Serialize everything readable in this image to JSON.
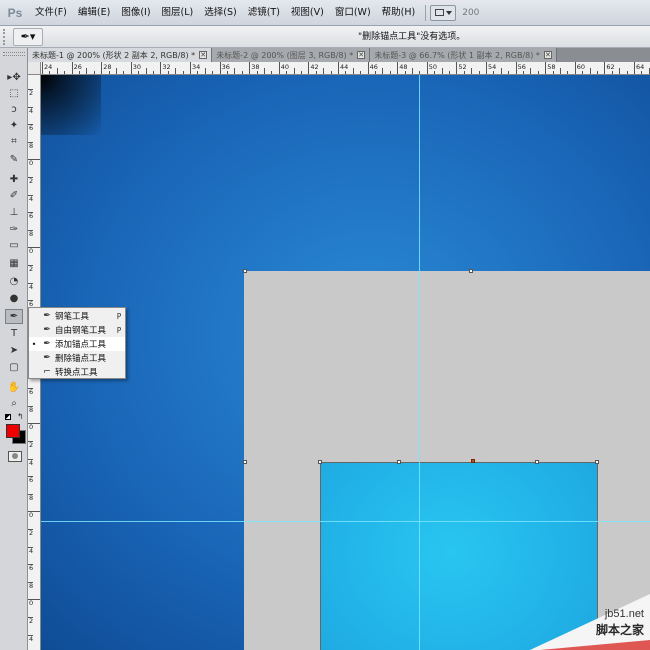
{
  "app": {
    "logo": "Ps"
  },
  "menubar": {
    "items": [
      "文件(F)",
      "编辑(E)",
      "图像(I)",
      "图层(L)",
      "选择(S)",
      "滤镜(T)",
      "视图(V)",
      "窗口(W)",
      "帮助(H)"
    ],
    "zoom": "200"
  },
  "options": {
    "tool_icon": "✒▾",
    "message": "\"删除锚点工具\"没有选项。"
  },
  "tabs": [
    {
      "label": "未标题-1 @ 200% (形状 2 副本 2, RGB/8) *",
      "close": "✕"
    },
    {
      "label": "未标题-2 @ 200% (图层 3, RGB/8) *",
      "close": "✕"
    },
    {
      "label": "未标题-3 @ 66.7% (形状 1 副本 2, RGB/8) *",
      "close": "✕"
    }
  ],
  "ruler": {
    "top": [
      "24",
      "26",
      "28",
      "30",
      "32",
      "34",
      "36",
      "38",
      "40",
      "42",
      "44",
      "46",
      "48",
      "50",
      "52",
      "54",
      "56",
      "58",
      "60",
      "62",
      "64"
    ],
    "left": [
      "2",
      "4",
      "6",
      "8",
      "0",
      "2",
      "4",
      "6",
      "8",
      "0",
      "2",
      "4",
      "6",
      "8",
      "0",
      "2",
      "4",
      "6",
      "8",
      "0",
      "2",
      "4",
      "6",
      "8",
      "0",
      "2",
      "4",
      "6",
      "8",
      "0",
      "2",
      "4",
      "6"
    ]
  },
  "toolbar": {
    "tools": [
      {
        "icon": "move-icon",
        "glyph": "▸✥"
      },
      {
        "icon": "marquee-icon",
        "glyph": "⬚"
      },
      {
        "icon": "lasso-icon",
        "glyph": "ↄ"
      },
      {
        "icon": "magic-wand-icon",
        "glyph": "✦"
      },
      {
        "icon": "crop-icon",
        "glyph": "⌗"
      },
      {
        "icon": "eyedropper-icon",
        "glyph": "✎"
      },
      {
        "icon": "healing-icon",
        "glyph": "✚"
      },
      {
        "icon": "brush-icon",
        "glyph": "✐"
      },
      {
        "icon": "stamp-icon",
        "glyph": "⊥"
      },
      {
        "icon": "history-brush-icon",
        "glyph": "✑"
      },
      {
        "icon": "eraser-icon",
        "glyph": "▭"
      },
      {
        "icon": "gradient-icon",
        "glyph": "▦"
      },
      {
        "icon": "blur-icon",
        "glyph": "◔"
      },
      {
        "icon": "dodge-icon",
        "glyph": "●"
      },
      {
        "icon": "pen-icon",
        "glyph": "✒"
      },
      {
        "icon": "type-icon",
        "glyph": "T"
      },
      {
        "icon": "path-select-icon",
        "glyph": "➤"
      },
      {
        "icon": "shape-icon",
        "glyph": "▢"
      },
      {
        "icon": "hand-icon",
        "glyph": "✋"
      },
      {
        "icon": "zoom-icon",
        "glyph": "⌕"
      }
    ],
    "foreground_color": "#ee0000",
    "background_color": "#000000"
  },
  "flyout": {
    "items": [
      {
        "label": "钢笔工具",
        "key": "P",
        "icon": "✒",
        "bullet": ""
      },
      {
        "label": "自由钢笔工具",
        "key": "P",
        "icon": "✒",
        "bullet": ""
      },
      {
        "label": "添加锚点工具",
        "key": "",
        "icon": "✒",
        "bullet": "•"
      },
      {
        "label": "删除锚点工具",
        "key": "",
        "icon": "✒",
        "bullet": ""
      },
      {
        "label": "转换点工具",
        "key": "",
        "icon": "⌐",
        "bullet": ""
      }
    ]
  },
  "watermark": {
    "site": "jb51.net",
    "cn": "脚本之家"
  }
}
